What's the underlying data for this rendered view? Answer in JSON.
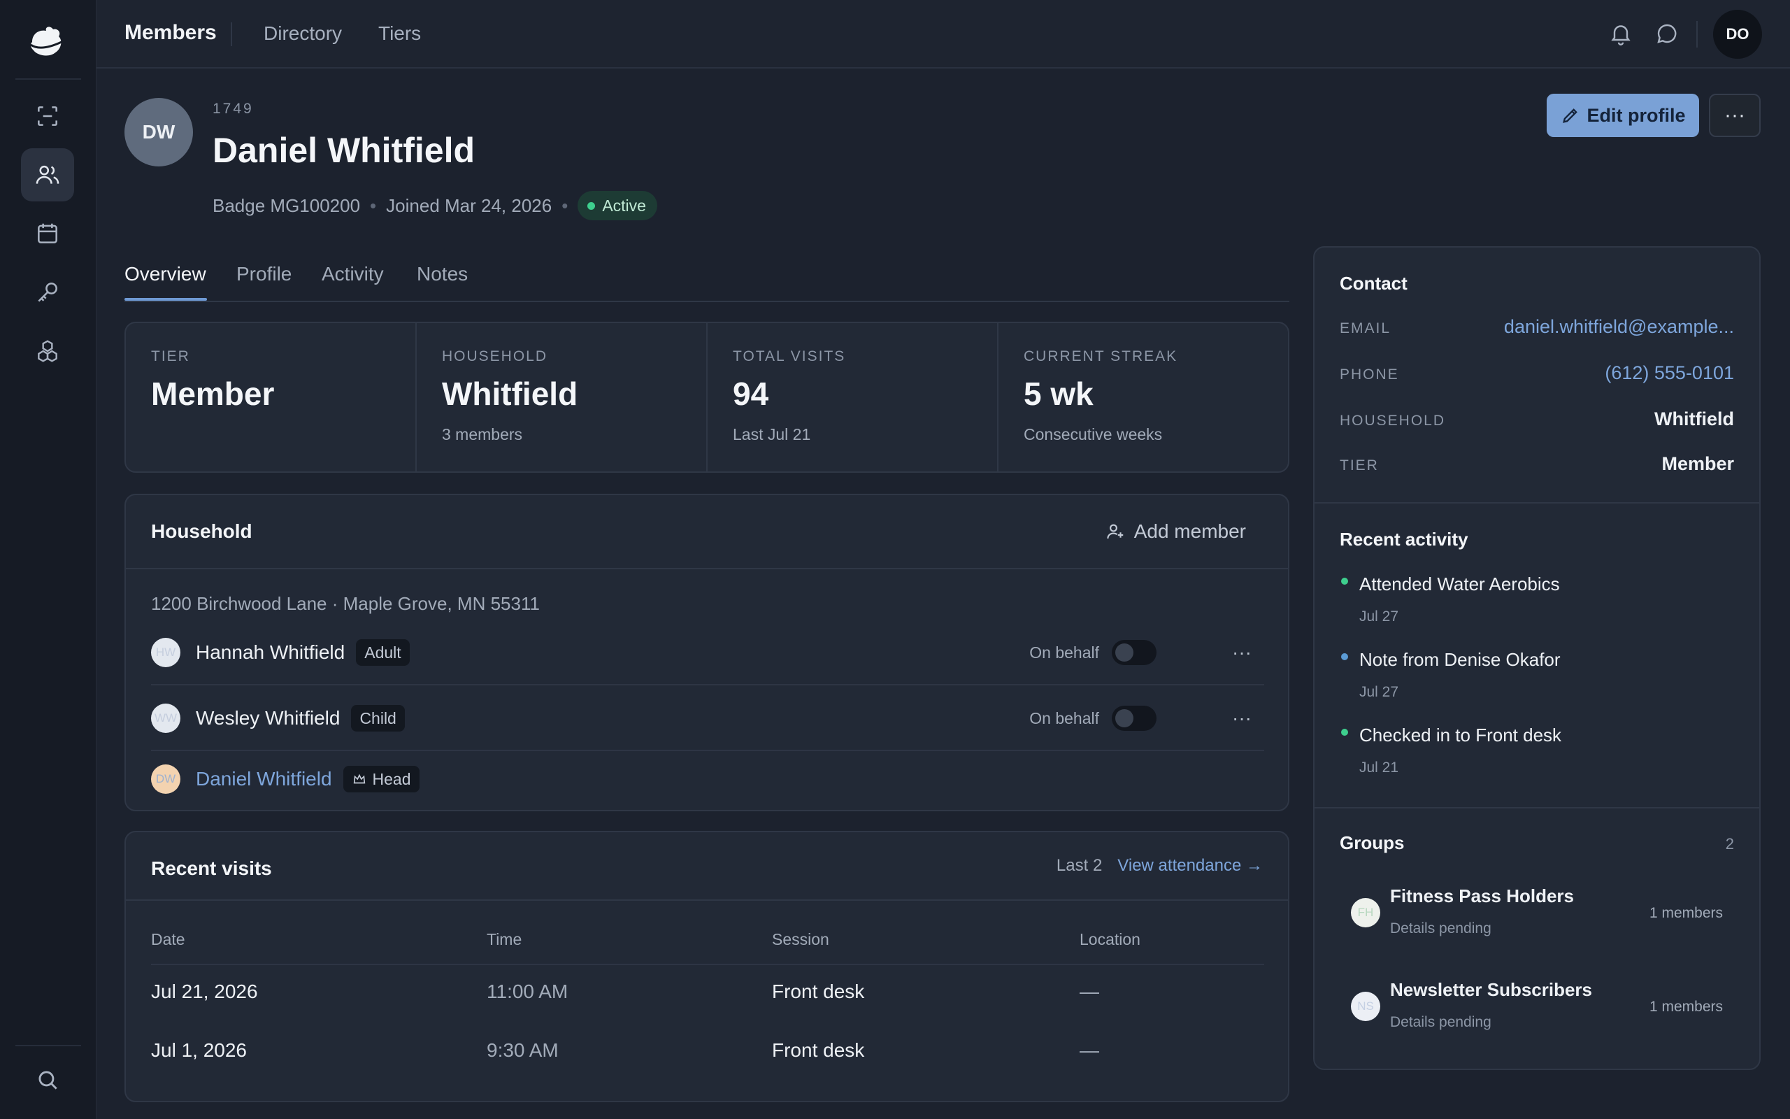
{
  "app": {
    "title": "Members",
    "nav": [
      "Directory",
      "Tiers"
    ],
    "user_initials": "DO"
  },
  "rail": {
    "items": [
      "scan-icon",
      "members-icon",
      "calendar-icon",
      "key-icon",
      "boxes-icon"
    ],
    "bottom": "search-icon"
  },
  "member": {
    "initials": "DW",
    "id": "1749",
    "name": "Daniel Whitfield",
    "badge": "Badge MG100200",
    "joined": "Joined Mar 24, 2026",
    "status": "Active",
    "edit_label": "Edit profile",
    "more_label": "···"
  },
  "tabs": [
    "Overview",
    "Profile",
    "Activity",
    "Notes"
  ],
  "stats": [
    {
      "label": "TIER",
      "value": "Member",
      "sub": ""
    },
    {
      "label": "HOUSEHOLD",
      "value": "Whitfield",
      "sub": "3 members"
    },
    {
      "label": "TOTAL VISITS",
      "value": "94",
      "sub": "Last Jul 21"
    },
    {
      "label": "CURRENT STREAK",
      "value": "5 wk",
      "sub": "Consecutive weeks"
    }
  ],
  "household": {
    "title": "Household",
    "add_label": "Add member",
    "address": "1200 Birchwood Lane · Maple Grove, MN 55311",
    "members": [
      {
        "initials": "HW",
        "name": "Hannah Whitfield",
        "role": "Adult",
        "behalf": "On behalf",
        "more": "···"
      },
      {
        "initials": "WW",
        "name": "Wesley Whitfield",
        "role": "Child",
        "behalf": "On behalf",
        "more": "···"
      },
      {
        "initials": "DW",
        "name": "Daniel Whitfield",
        "role": "Head"
      }
    ]
  },
  "visits": {
    "title": "Recent visits",
    "count_label": "Last 2",
    "link_label": "View attendance",
    "columns": [
      "Date",
      "Time",
      "Session",
      "Location"
    ],
    "rows": [
      [
        "Jul 21, 2026",
        "11:00 AM",
        "Front desk",
        "—"
      ],
      [
        "Jul 1, 2026",
        "9:30 AM",
        "Front desk",
        "—"
      ]
    ]
  },
  "contact": {
    "title": "Contact",
    "rows": [
      {
        "label": "EMAIL",
        "value": "daniel.whitfield@example..."
      },
      {
        "label": "PHONE",
        "value": "(612) 555-0101"
      },
      {
        "label": "HOUSEHOLD",
        "value": "Whitfield"
      },
      {
        "label": "TIER",
        "value": "Member"
      }
    ]
  },
  "recent_activity": {
    "title": "Recent activity",
    "items": [
      {
        "title": "Attended Water Aerobics",
        "date": "Jul 27",
        "color": "#3ecf8e"
      },
      {
        "title": "Note from Denise Okafor",
        "date": "Jul 27",
        "color": "#5b9bd5"
      },
      {
        "title": "Checked in to Front desk",
        "date": "Jul 21",
        "color": "#3ecf8e"
      }
    ]
  },
  "groups": {
    "title": "Groups",
    "count": "2",
    "items": [
      {
        "initials": "FH",
        "name": "Fitness Pass Holders",
        "sub": "Details pending",
        "members": "1 members"
      },
      {
        "initials": "NS",
        "name": "Newsletter Subscribers",
        "sub": "Details pending",
        "members": "1 members"
      }
    ]
  },
  "colors": {
    "accent": "#7aa1d6",
    "background": "#1c222e",
    "panel": "#222936",
    "active": "#3ecf8e"
  }
}
